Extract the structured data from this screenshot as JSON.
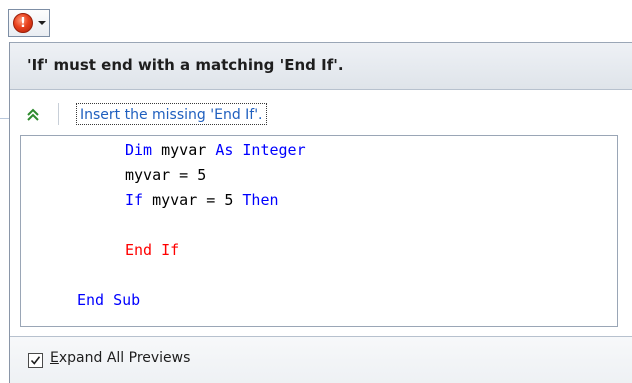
{
  "smart_tag": {
    "icon": "error-icon",
    "icon_glyph": "!",
    "dropdown_icon": "chevron-down-icon"
  },
  "header": {
    "message": "'If' must end with a matching 'End If'."
  },
  "fix": {
    "collapse_icon": "double-chevron-up-icon",
    "collapse_glyph": "»",
    "label": "Insert the missing 'End If'."
  },
  "preview": {
    "lines": [
      {
        "indent": "    ",
        "tokens": [
          {
            "t": "Dim",
            "c": "kw"
          },
          {
            "t": " myvar ",
            "c": "tx"
          },
          {
            "t": "As",
            "c": "kw"
          },
          {
            "t": " ",
            "c": "tx"
          },
          {
            "t": "Integer",
            "c": "kw"
          }
        ]
      },
      {
        "indent": "    ",
        "tokens": [
          {
            "t": "myvar = 5",
            "c": "tx"
          }
        ]
      },
      {
        "indent": "    ",
        "tokens": [
          {
            "t": "If",
            "c": "kw"
          },
          {
            "t": " myvar = 5 ",
            "c": "tx"
          },
          {
            "t": "Then",
            "c": "kw"
          }
        ]
      },
      {
        "indent": "",
        "tokens": []
      },
      {
        "indent": "    ",
        "tokens": [
          {
            "t": "End If",
            "c": "er"
          }
        ]
      },
      {
        "indent": "",
        "tokens": []
      },
      {
        "indent": "",
        "tokens": [
          {
            "t": "End",
            "c": "kw"
          },
          {
            "t": " ",
            "c": "tx"
          },
          {
            "t": "Sub",
            "c": "kw"
          }
        ]
      }
    ]
  },
  "footer": {
    "checked": true,
    "label_accel": "E",
    "label_rest": "xpand All Previews"
  },
  "colors": {
    "keyword": "#0000ff",
    "inserted_code": "#ff0000",
    "link": "#1f5fbf",
    "error": "#e8401c"
  }
}
